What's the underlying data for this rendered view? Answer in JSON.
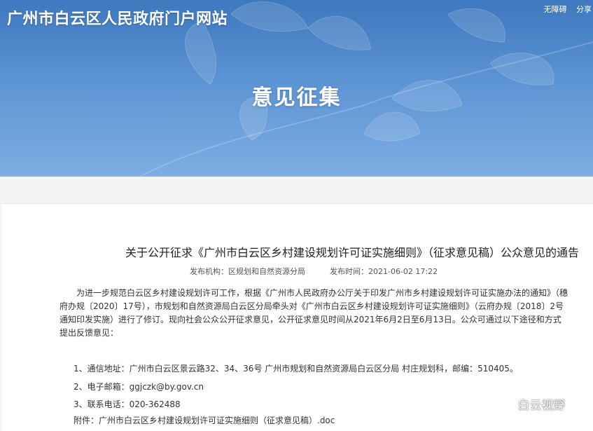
{
  "header": {
    "site_title": "广州市白云区人民政府门户网站",
    "accessibility": "无障碍",
    "share": "分享",
    "section_title": "意见征集"
  },
  "article": {
    "title": "关于公开征求《广州市白云区乡村建设规划许可证实施细则》（征求意见稿）公众意见的通告",
    "publisher": "发布机构：区规划和自然资源分局",
    "publish_time": "发布时间：2021-06-02 17:22",
    "paragraph": "为进一步规范白云区乡村建设规划许可工作，根据《广州市人民政府办公厅关于印发广州市乡村建设规划许可证实施办法的通知》（穗府办规〔2020〕17号），市规划和自然资源局白云区分局牵头对《广州市白云区乡村建设规划许可证实施细则》（云府办规〔2018〕2号通知印发实施）进行了修订。现向社会公众公开征求意见，公开征求意见时间从2021年6月2日至6月13日。公众可通过以下途径和方式提出反馈意见：",
    "item1": "1、通信地址：广州市白云区景云路32、34、36号 广州市规划和自然资源局白云区分局 村庄规划科，邮编：510405。",
    "item2": "2、电子邮箱：ggjczk@by.gov.cn",
    "item3": "3、联系电话：020-362488",
    "attachment": "附件：广州市白云区乡村建设规划许可证实施细则（征求意见稿）.doc"
  },
  "watermark": {
    "text": "白云视野",
    "icon": "wechat-icon"
  },
  "colors": {
    "banner_top": "#3e78be",
    "banner_bottom": "#7eaee2",
    "page_bg": "#f3f3f3"
  }
}
